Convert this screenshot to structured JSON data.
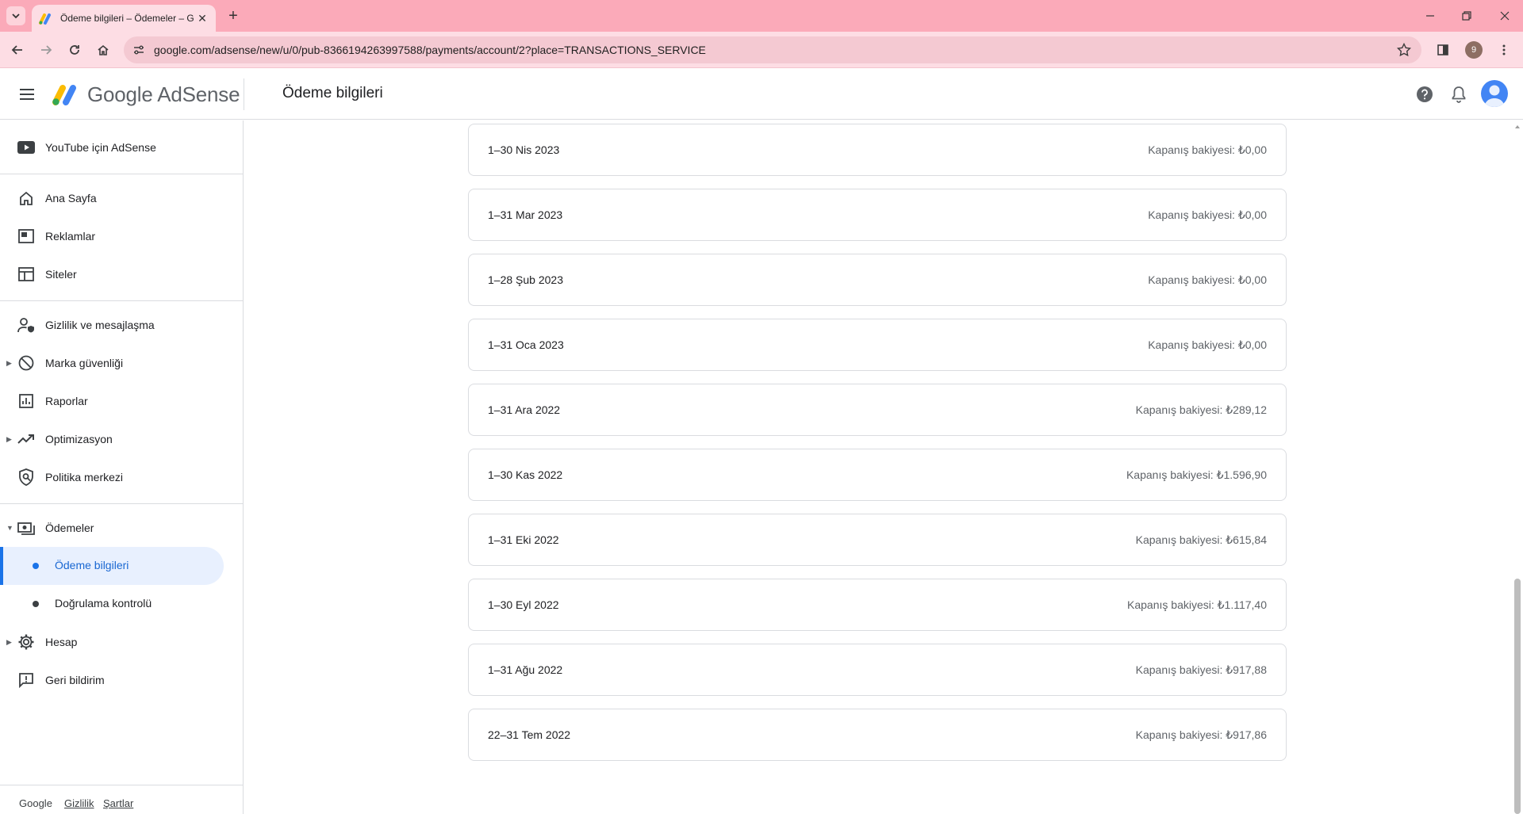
{
  "browser": {
    "tab_title": "Ödeme bilgileri – Ödemeler – G",
    "url": "google.com/adsense/new/u/0/pub-8366194263997588/payments/account/2?place=TRANSACTIONS_SERVICE",
    "profile_initial": "9"
  },
  "header": {
    "brand": "Google AdSense",
    "page_title": "Ödeme bilgileri"
  },
  "sidebar": {
    "youtube": "YouTube için AdSense",
    "items": [
      {
        "label": "Ana Sayfa"
      },
      {
        "label": "Reklamlar"
      },
      {
        "label": "Siteler"
      },
      {
        "label": "Gizlilik ve mesajlaşma"
      },
      {
        "label": "Marka güvenliği"
      },
      {
        "label": "Raporlar"
      },
      {
        "label": "Optimizasyon"
      },
      {
        "label": "Politika merkezi"
      },
      {
        "label": "Ödemeler"
      },
      {
        "label": "Hesap"
      },
      {
        "label": "Geri bildirim"
      }
    ],
    "payments_sub": [
      {
        "label": "Ödeme bilgileri"
      },
      {
        "label": "Doğrulama kontrolü"
      }
    ],
    "footer": {
      "google": "Google",
      "privacy": "Gizlilik",
      "terms": "Şartlar"
    }
  },
  "statements": [
    {
      "period": "1–30 Nis 2023",
      "balance": "Kapanış bakiyesi: ₺0,00"
    },
    {
      "period": "1–31 Mar 2023",
      "balance": "Kapanış bakiyesi: ₺0,00"
    },
    {
      "period": "1–28 Şub 2023",
      "balance": "Kapanış bakiyesi: ₺0,00"
    },
    {
      "period": "1–31 Oca 2023",
      "balance": "Kapanış bakiyesi: ₺0,00"
    },
    {
      "period": "1–31 Ara 2022",
      "balance": "Kapanış bakiyesi: ₺289,12"
    },
    {
      "period": "1–30 Kas 2022",
      "balance": "Kapanış bakiyesi: ₺1.596,90"
    },
    {
      "period": "1–31 Eki 2022",
      "balance": "Kapanış bakiyesi: ₺615,84"
    },
    {
      "period": "1–30 Eyl 2022",
      "balance": "Kapanış bakiyesi: ₺1.117,40"
    },
    {
      "period": "1–31 Ağu 2022",
      "balance": "Kapanış bakiyesi: ₺917,88"
    },
    {
      "period": "22–31 Tem 2022",
      "balance": "Kapanış bakiyesi: ₺917,86"
    }
  ],
  "colors": {
    "tabbar": "#fbaab9",
    "toolbar": "#fddde4",
    "accent": "#1a73e8",
    "active_bg": "#e8f0fe"
  }
}
